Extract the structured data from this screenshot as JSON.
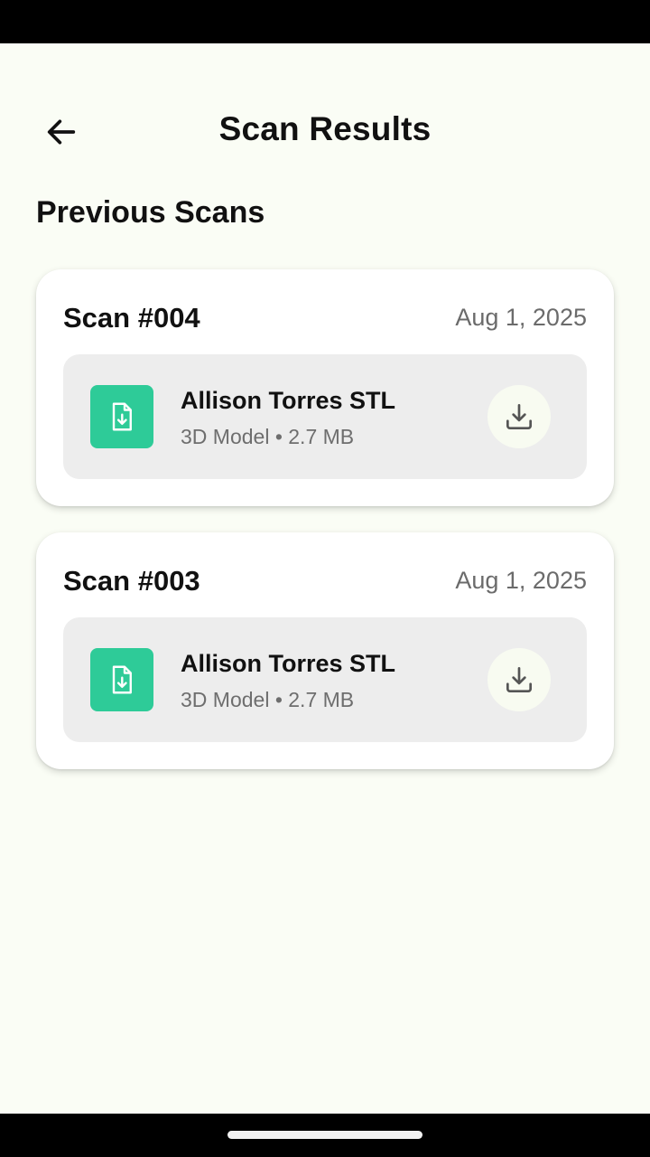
{
  "header": {
    "title": "Scan Results",
    "back_icon": "arrow-left-icon"
  },
  "section": {
    "title": "Previous Scans"
  },
  "scans": [
    {
      "title": "Scan #004",
      "date": "Aug 1, 2025",
      "file": {
        "name": "Allison Torres STL",
        "meta": "3D Model • 2.7 MB",
        "icon": "file-download-icon",
        "action_icon": "download-icon"
      }
    },
    {
      "title": "Scan #003",
      "date": "Aug 1, 2025",
      "file": {
        "name": "Allison Torres STL",
        "meta": "3D Model • 2.7 MB",
        "icon": "file-download-icon",
        "action_icon": "download-icon"
      }
    }
  ],
  "colors": {
    "background": "#fafdf5",
    "file_icon_bg": "#2ecb98",
    "file_row_bg": "#ededed",
    "download_button_bg": "#f8fbf1"
  }
}
